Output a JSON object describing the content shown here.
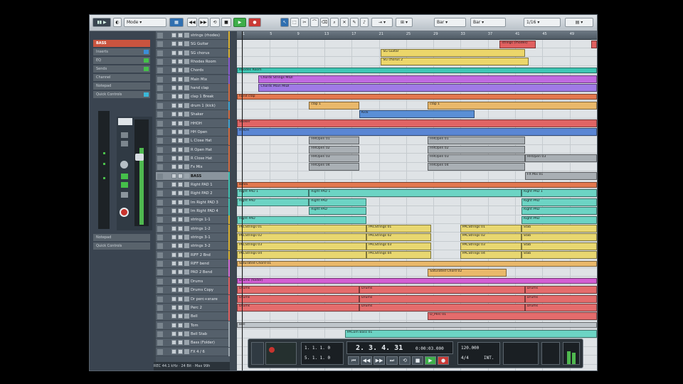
{
  "toolbar": {
    "mode_label": "Mode",
    "snap_label": "Bar",
    "quantize_label": "1/16",
    "grid_label": "Bar",
    "zoom_label": "Bar"
  },
  "inspector": {
    "header": "BASS",
    "rows": [
      "Inserts",
      "EQ",
      "Sends",
      "Channel",
      "Notepad",
      "Quick Controls"
    ],
    "bottom_rows": [
      "Notepad",
      "Quick Controls"
    ]
  },
  "ruler": {
    "bars": [
      "1",
      "5",
      "9",
      "13",
      "17",
      "21",
      "25",
      "29",
      "33",
      "37",
      "41",
      "45",
      "49"
    ]
  },
  "tracks": [
    {
      "name": "strings (rhodes)",
      "color": "#d9b030"
    },
    {
      "name": "SG Guitar",
      "color": "#d9b030"
    },
    {
      "name": "SG chorus",
      "color": "#d9b030"
    },
    {
      "name": "Rhodes Room",
      "color": "#8a5ad0"
    },
    {
      "name": "Chords",
      "color": "#8a5ad0"
    },
    {
      "name": "Main Mix",
      "color": "#8a5ad0"
    },
    {
      "name": "hand clap",
      "color": "#d06a40"
    },
    {
      "name": "clap 1 Break",
      "color": "#d06a40"
    },
    {
      "name": "drum 1 (kick)",
      "color": "#3fa3d0"
    },
    {
      "name": "Shaker",
      "color": "#d06a40"
    },
    {
      "name": "HHOH",
      "color": "#3fa3d0"
    },
    {
      "name": "HH Open",
      "color": "#d06a40"
    },
    {
      "name": "L Close Hat",
      "color": "#d06a40"
    },
    {
      "name": "R Open Hat",
      "color": "#d06a40"
    },
    {
      "name": "R Close Hat",
      "color": "#d06a40"
    },
    {
      "name": "Fx Mix",
      "color": "#d06a40"
    },
    {
      "name": "BASS",
      "color": "#3fc0b0",
      "selected": true
    },
    {
      "name": "Right PAD 1",
      "color": "#3fc0b0"
    },
    {
      "name": "Right PAD 2",
      "color": "#3fc0b0"
    },
    {
      "name": "Im Right PAD 3",
      "color": "#3fc0b0"
    },
    {
      "name": "Im Right PAD 4",
      "color": "#3fc0b0"
    },
    {
      "name": "strings 1-1",
      "color": "#d9b030"
    },
    {
      "name": "strings 1-2",
      "color": "#d9b030"
    },
    {
      "name": "strings 3-1",
      "color": "#d9b030"
    },
    {
      "name": "strings 3-2",
      "color": "#d9b030"
    },
    {
      "name": "RIFF 2 Bnd",
      "color": "#d9b030"
    },
    {
      "name": "RIFF bend",
      "color": "#d56bd5"
    },
    {
      "name": "PAD 2 Bend",
      "color": "#d56bd5"
    },
    {
      "name": "Drums",
      "color": "#e06060"
    },
    {
      "name": "Drums Copy",
      "color": "#e06060"
    },
    {
      "name": "Dr perc+snare",
      "color": "#e06060"
    },
    {
      "name": "Perc 2",
      "color": "#e06060"
    },
    {
      "name": "Bell",
      "color": "#e06060"
    },
    {
      "name": "Tom",
      "color": "#9aa4ac"
    },
    {
      "name": "Bell Stab",
      "color": "#9aa4ac"
    },
    {
      "name": "Bass (Folder)",
      "color": "#9aa4ac"
    },
    {
      "name": "FX 4 / 6",
      "color": "#9aa4ac"
    }
  ],
  "clips": [
    {
      "lane": 0,
      "start": 0.73,
      "end": 0.83,
      "color": "#e06060",
      "label": "strings (rhodes)"
    },
    {
      "lane": 0,
      "start": 0.985,
      "end": 1.0,
      "color": "#e06060",
      "label": ""
    },
    {
      "lane": 1,
      "start": 0.4,
      "end": 0.8,
      "color": "#ecd66a",
      "label": "SG Guitar"
    },
    {
      "lane": 2,
      "start": 0.4,
      "end": 0.81,
      "color": "#ecd66a",
      "label": "SG chorus 2"
    },
    {
      "lane": 3,
      "start": 0.0,
      "end": 1.0,
      "color": "#3fc6b4",
      "label": "Rhodes Room",
      "folder": true
    },
    {
      "lane": 4,
      "start": 0.06,
      "end": 1.0,
      "color": "#c06ae0",
      "label": "Chords Strings MIDI"
    },
    {
      "lane": 5,
      "start": 0.06,
      "end": 1.0,
      "color": "#a07ae6",
      "label": "Chords Main MIDI"
    },
    {
      "lane": 6,
      "start": 0.0,
      "end": 1.0,
      "color": "#e3784f",
      "label": "hand clap",
      "folder": true
    },
    {
      "lane": 7,
      "start": 0.2,
      "end": 0.34,
      "color": "#e9b86a",
      "label": "clap 1"
    },
    {
      "lane": 7,
      "start": 0.53,
      "end": 1.0,
      "color": "#e9b86a",
      "label": "clap 1"
    },
    {
      "lane": 8,
      "start": 0.34,
      "end": 0.66,
      "color": "#5a8fd6",
      "label": "Kick"
    },
    {
      "lane": 9,
      "start": 0.0,
      "end": 1.0,
      "color": "#e06464",
      "label": "Shaker"
    },
    {
      "lane": 10,
      "start": 0.0,
      "end": 1.0,
      "color": "#5a86d4",
      "label": "HHOH"
    },
    {
      "lane": 11,
      "start": 0.2,
      "end": 0.34,
      "color": "#a9afb4",
      "label": "HHOpen 01"
    },
    {
      "lane": 11,
      "start": 0.53,
      "end": 0.8,
      "color": "#a9afb4",
      "label": "HHOpen 01"
    },
    {
      "lane": 12,
      "start": 0.2,
      "end": 0.34,
      "color": "#a9afb4",
      "label": "HHOpen 02"
    },
    {
      "lane": 12,
      "start": 0.53,
      "end": 0.8,
      "color": "#a9afb4",
      "label": "HHOpen 02"
    },
    {
      "lane": 13,
      "start": 0.2,
      "end": 0.34,
      "color": "#a9afb4",
      "label": "HHOpen 03"
    },
    {
      "lane": 13,
      "start": 0.53,
      "end": 0.8,
      "color": "#a9afb4",
      "label": "HHOpen 03"
    },
    {
      "lane": 13,
      "start": 0.8,
      "end": 1.0,
      "color": "#a9afb4",
      "label": "HHOpen 03"
    },
    {
      "lane": 14,
      "start": 0.2,
      "end": 0.34,
      "color": "#a9afb4",
      "label": "HHOpen 04"
    },
    {
      "lane": 14,
      "start": 0.53,
      "end": 0.8,
      "color": "#a9afb4",
      "label": "HHOpen 04"
    },
    {
      "lane": 15,
      "start": 0.8,
      "end": 1.0,
      "color": "#a9afb4",
      "label": "FX Mix 01"
    },
    {
      "lane": 16,
      "start": 0.0,
      "end": 1.0,
      "color": "#e3784f",
      "label": "BASS",
      "folder": true
    },
    {
      "lane": 17,
      "start": 0.0,
      "end": 0.2,
      "color": "#6cd4c4",
      "label": "Right PAD 1"
    },
    {
      "lane": 17,
      "start": 0.2,
      "end": 0.79,
      "color": "#6cd4c4",
      "label": "Right PAD 1"
    },
    {
      "lane": 17,
      "start": 0.79,
      "end": 1.0,
      "color": "#6cd4c4",
      "label": "Right PAD 1"
    },
    {
      "lane": 18,
      "start": 0.0,
      "end": 0.2,
      "color": "#6cd4c4",
      "label": "Right PAD"
    },
    {
      "lane": 18,
      "start": 0.2,
      "end": 0.36,
      "color": "#6cd4c4",
      "label": "Right PAD"
    },
    {
      "lane": 18,
      "start": 0.79,
      "end": 1.0,
      "color": "#6cd4c4",
      "label": "Right PAD"
    },
    {
      "lane": 19,
      "start": 0.2,
      "end": 0.36,
      "color": "#6cd4c4",
      "label": "Right PAD"
    },
    {
      "lane": 19,
      "start": 0.79,
      "end": 1.0,
      "color": "#6cd4c4",
      "label": "Right PAD"
    },
    {
      "lane": 20,
      "start": 0.0,
      "end": 0.36,
      "color": "#6cd4c4",
      "label": "Right PAD"
    },
    {
      "lane": 20,
      "start": 0.79,
      "end": 1.0,
      "color": "#6cd4c4",
      "label": "Right PAD"
    },
    {
      "lane": 21,
      "start": 0.0,
      "end": 0.36,
      "color": "#e8d770",
      "label": "PACStrings 01"
    },
    {
      "lane": 21,
      "start": 0.36,
      "end": 0.54,
      "color": "#e8d770",
      "label": "PACStrings 01"
    },
    {
      "lane": 21,
      "start": 0.62,
      "end": 0.79,
      "color": "#e8d770",
      "label": "PACStrings 01"
    },
    {
      "lane": 21,
      "start": 0.79,
      "end": 1.0,
      "color": "#e8d770",
      "label": "Stab"
    },
    {
      "lane": 22,
      "start": 0.0,
      "end": 0.36,
      "color": "#e8d770",
      "label": "PACStrings 02"
    },
    {
      "lane": 22,
      "start": 0.36,
      "end": 0.54,
      "color": "#e8d770",
      "label": "PACStrings 02"
    },
    {
      "lane": 22,
      "start": 0.62,
      "end": 0.79,
      "color": "#e8d770",
      "label": "PACStrings 02"
    },
    {
      "lane": 22,
      "start": 0.79,
      "end": 1.0,
      "color": "#e8d770",
      "label": "Stab"
    },
    {
      "lane": 23,
      "start": 0.0,
      "end": 0.36,
      "color": "#e8d770",
      "label": "PACStrings 03"
    },
    {
      "lane": 23,
      "start": 0.36,
      "end": 0.54,
      "color": "#e8d770",
      "label": "PACStrings 03"
    },
    {
      "lane": 23,
      "start": 0.62,
      "end": 0.79,
      "color": "#e8d770",
      "label": "PACStrings 03"
    },
    {
      "lane": 23,
      "start": 0.79,
      "end": 1.0,
      "color": "#e8d770",
      "label": "Stab"
    },
    {
      "lane": 24,
      "start": 0.0,
      "end": 0.36,
      "color": "#e8d770",
      "label": "PACStrings 04"
    },
    {
      "lane": 24,
      "start": 0.36,
      "end": 0.54,
      "color": "#e8d770",
      "label": "PACStrings 04"
    },
    {
      "lane": 24,
      "start": 0.62,
      "end": 0.79,
      "color": "#e8d770",
      "label": "PACStrings 04"
    },
    {
      "lane": 24,
      "start": 0.79,
      "end": 1.0,
      "color": "#e8d770",
      "label": "Stab"
    },
    {
      "lane": 25,
      "start": 0.0,
      "end": 1.0,
      "color": "#e9b86a",
      "label": "Saturated Chord 01",
      "folder": true
    },
    {
      "lane": 26,
      "start": 0.53,
      "end": 0.75,
      "color": "#e9b86a",
      "label": "Saturated Chord 02"
    },
    {
      "lane": 27,
      "start": 0.0,
      "end": 1.0,
      "color": "#d35fd3",
      "label": "Drums (folder)",
      "folder": true
    },
    {
      "lane": 28,
      "start": 0.0,
      "end": 0.34,
      "color": "#e46c6c",
      "label": "Drums"
    },
    {
      "lane": 28,
      "start": 0.34,
      "end": 0.8,
      "color": "#e46c6c",
      "label": "Drums"
    },
    {
      "lane": 28,
      "start": 0.8,
      "end": 1.0,
      "color": "#e46c6c",
      "label": "Drums"
    },
    {
      "lane": 29,
      "start": 0.0,
      "end": 0.34,
      "color": "#e46c6c",
      "label": "Drums"
    },
    {
      "lane": 29,
      "start": 0.34,
      "end": 0.8,
      "color": "#e46c6c",
      "label": "Drums"
    },
    {
      "lane": 29,
      "start": 0.8,
      "end": 1.0,
      "color": "#e46c6c",
      "label": "Drums"
    },
    {
      "lane": 30,
      "start": 0.0,
      "end": 0.34,
      "color": "#e46c6c",
      "label": "Drums"
    },
    {
      "lane": 30,
      "start": 0.34,
      "end": 0.8,
      "color": "#e46c6c",
      "label": "Drums"
    },
    {
      "lane": 30,
      "start": 0.8,
      "end": 1.0,
      "color": "#e46c6c",
      "label": "Drums"
    },
    {
      "lane": 31,
      "start": 0.53,
      "end": 1.0,
      "color": "#e46c6c",
      "label": "D_Perc 01"
    },
    {
      "lane": 32,
      "start": 0.0,
      "end": 1.0,
      "color": "#bfc5ca",
      "label": "Bell",
      "folder": true
    },
    {
      "lane": 33,
      "start": 0.3,
      "end": 1.0,
      "color": "#6cd4c4",
      "label": "PACom Bass 01"
    }
  ],
  "transport": {
    "time_primary": "2. 3. 4. 31",
    "time_secondary": "0:00:03.000",
    "left_locator": "1. 1. 1. 0",
    "right_locator": "5. 1. 1. 0",
    "tempo": "120.000",
    "signature": "4/4",
    "sync_label": "INT."
  },
  "status": {
    "text": "REC 44.1 kHz · 24 Bit · Max 99h"
  }
}
